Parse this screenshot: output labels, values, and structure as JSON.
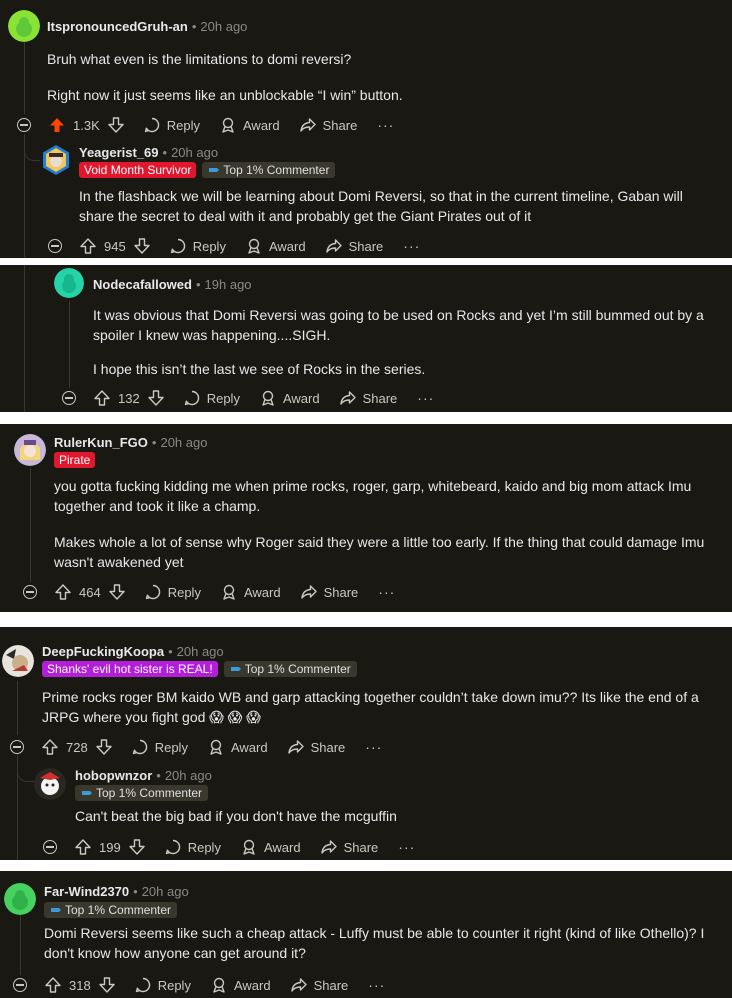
{
  "panels": [
    {
      "comment": {
        "username": "ItspronouncedGruh-an",
        "time": "20h ago",
        "paragraphs": [
          "Bruh what even is the limitations to domi reversi?",
          "Right now it just seems like an unblockable “I win” button."
        ],
        "votes": "1.3K",
        "upvoted": true
      },
      "reply": {
        "username": "Yeagerist_69",
        "time": "20h ago",
        "flair_primary": "Void Month Survivor",
        "flair_commenter": "Top 1% Commenter",
        "paragraphs": [
          "In the flashback we will be learning about Domi Reversi, so that in the current timeline, Gaban will share the secret to deal with it and probably get the Giant Pirates out of it"
        ],
        "votes": "945"
      }
    },
    {
      "comment": {
        "username": "Nodecafallowed",
        "time": "19h ago",
        "paragraphs": [
          "It was obvious that Domi Reversi was going to be used on Rocks and yet I’m still bummed out by a spoiler I knew was happening....SIGH.",
          "I hope this isn’t the last we see of Rocks in the series."
        ],
        "votes": "132"
      }
    },
    {
      "comment": {
        "username": "RulerKun_FGO",
        "time": "20h ago",
        "flair_primary": "Pirate",
        "paragraphs": [
          "you gotta fucking kidding me when prime rocks, roger, garp, whitebeard, kaido and big mom attack Imu together and took it like a champ.",
          "Makes whole a lot of sense why Roger said they were a little too early. If the thing that could damage Imu wasn't awakened yet"
        ],
        "votes": "464"
      }
    },
    {
      "comment": {
        "username": "DeepFuckingKoopa",
        "time": "20h ago",
        "flair_primary": "Shanks' evil hot sister is REAL!",
        "flair_commenter": "Top 1% Commenter",
        "paragraphs": [
          "Prime rocks roger BM kaido WB and garp attacking together couldn’t take down imu?? Its like the end of a JRPG where you fight god 😱 😱 😱"
        ],
        "votes": "728"
      },
      "reply": {
        "username": "hobopwnzor",
        "time": "20h ago",
        "flair_commenter": "Top 1% Commenter",
        "paragraphs": [
          "Can't beat the big bad if you don't have the mcguffin"
        ],
        "votes": "199"
      }
    },
    {
      "comment": {
        "username": "Far-Wind2370",
        "time": "20h ago",
        "flair_commenter": "Top 1% Commenter",
        "paragraphs": [
          "Domi Reversi seems like such a cheap attack - Luffy must be able to counter it right (kind of like Othello)? I don't know how anyone can get around it?"
        ],
        "votes": "318"
      }
    }
  ],
  "labels": {
    "reply": "Reply",
    "award": "Award",
    "share": "Share",
    "more": "···",
    "dot": "•"
  },
  "icons": [
    "collapse-icon",
    "upvote-icon",
    "downvote-icon",
    "reply-icon",
    "award-icon",
    "share-icon",
    "more-icon"
  ],
  "colors": {
    "background": "#1a1812",
    "upvoted": "#ff4500",
    "flair_red": "#e0172d",
    "flair_magenta": "#b31fd8",
    "flair_dark": "#3a372c",
    "snoo_green": "#46d160",
    "text_muted": "#8b8a82"
  }
}
